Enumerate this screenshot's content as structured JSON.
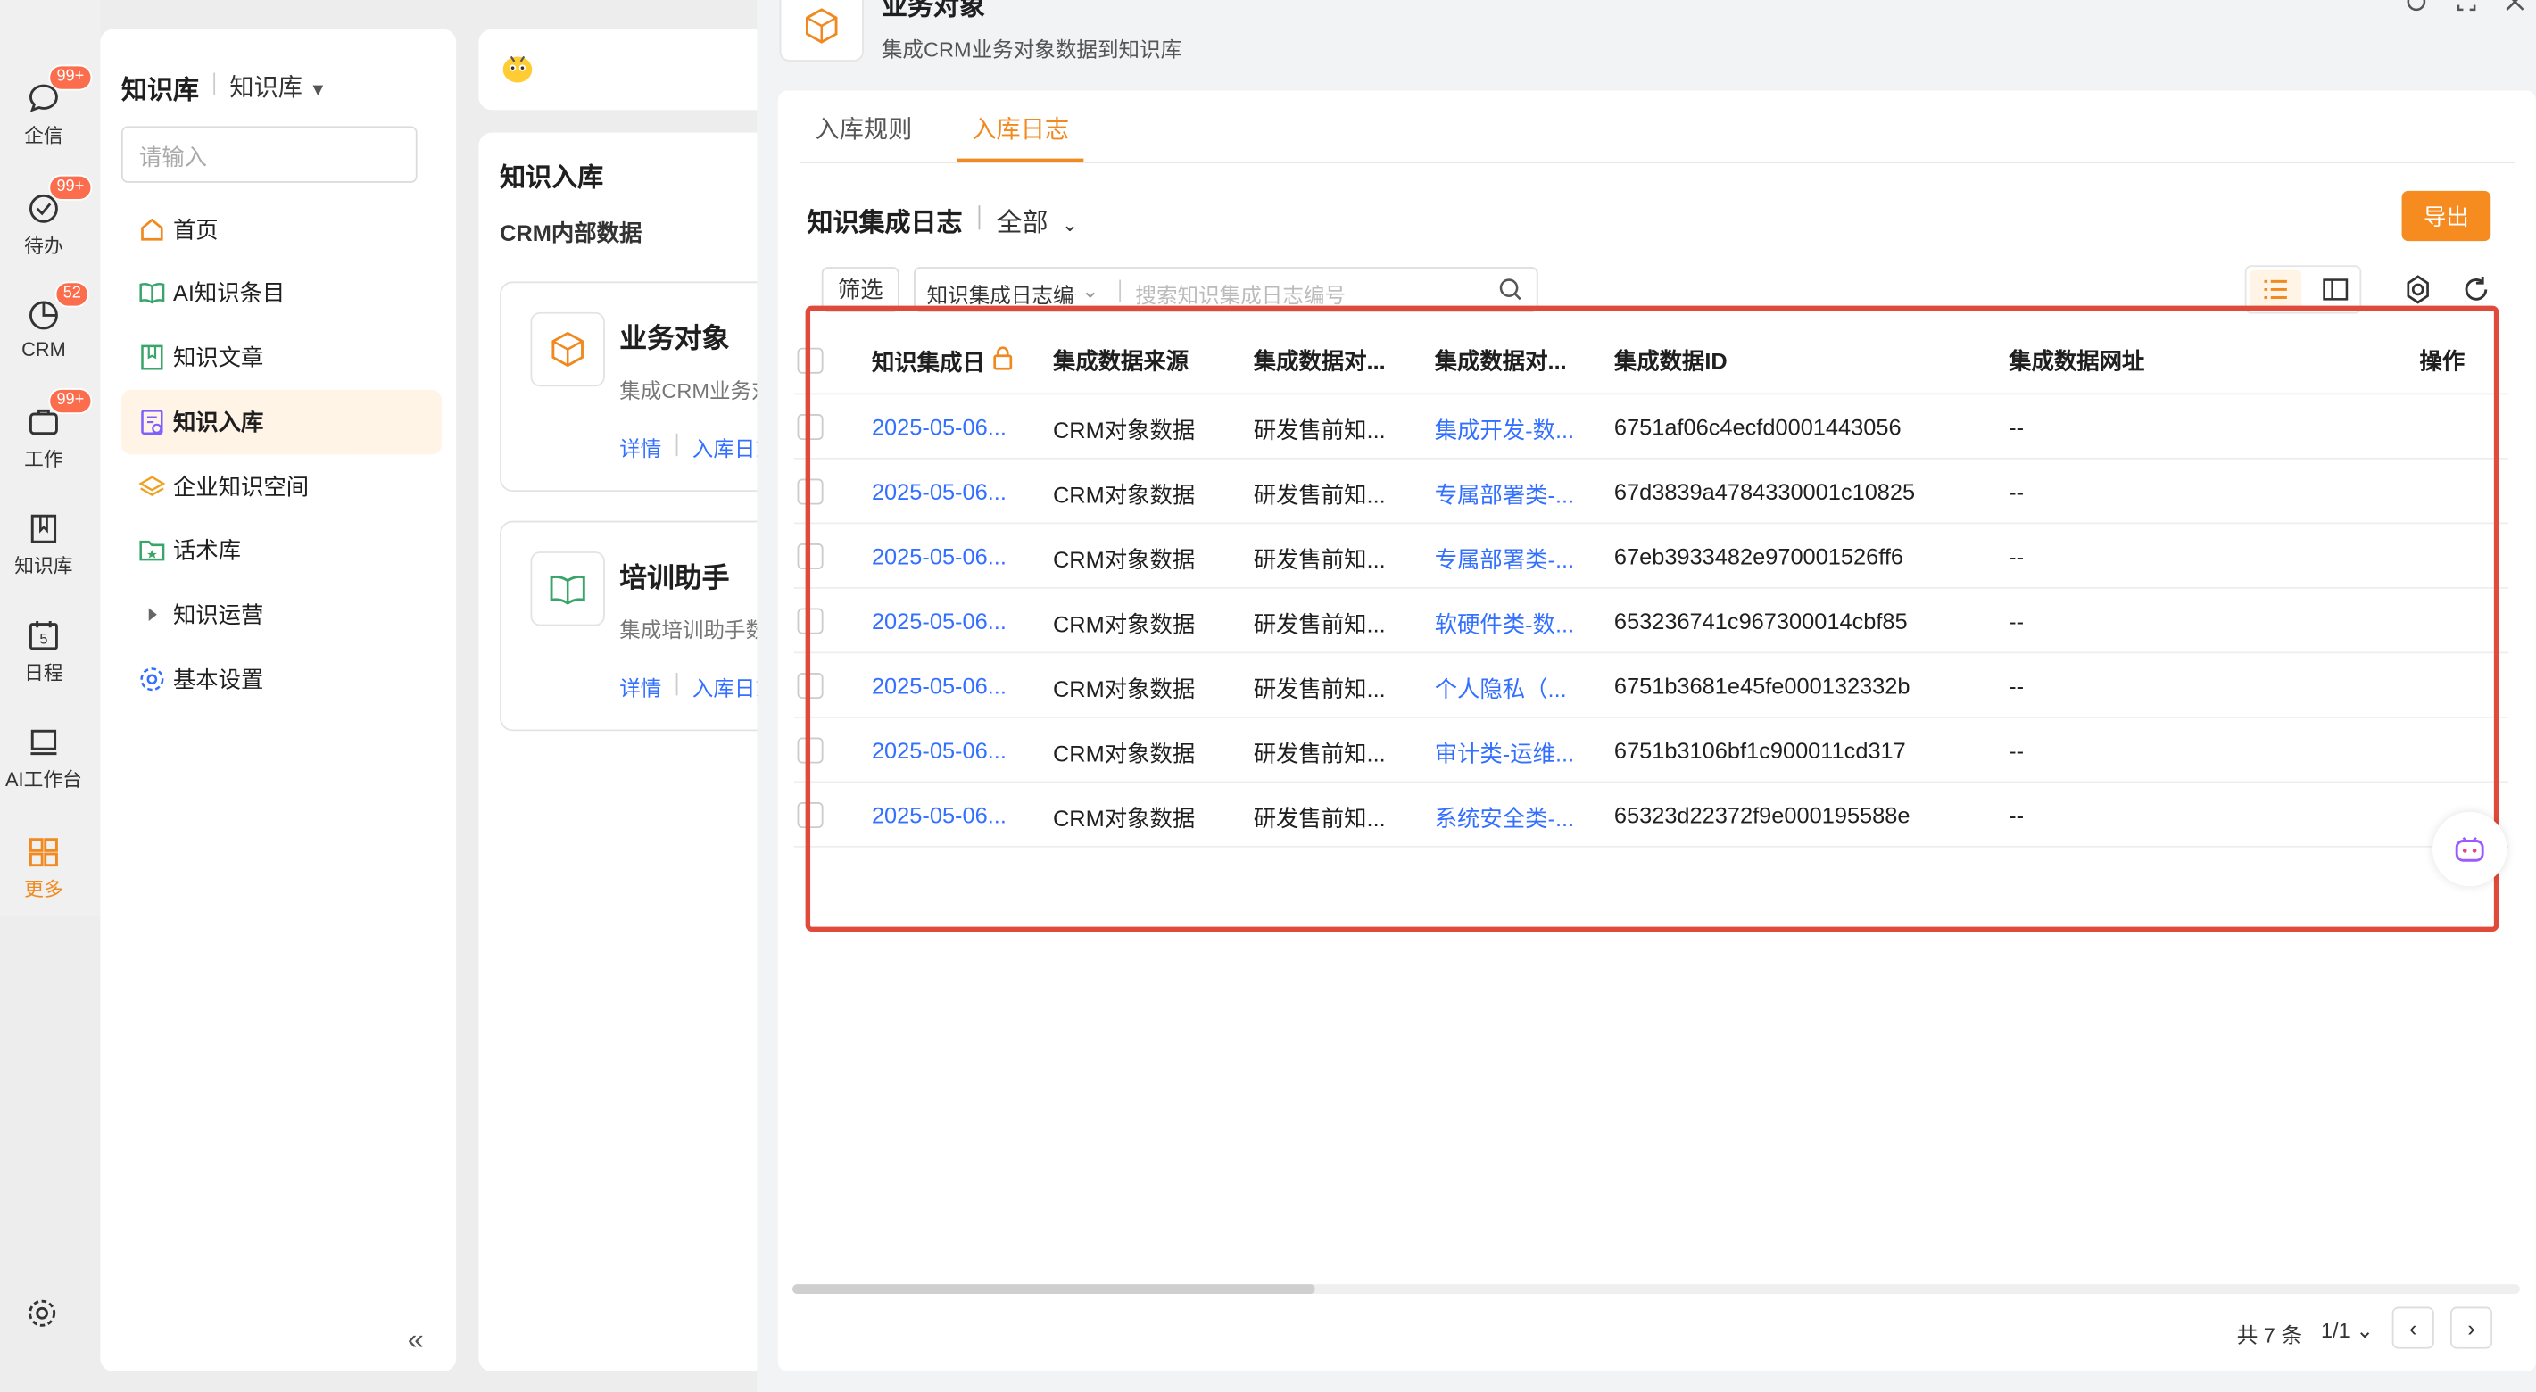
{
  "rail": {
    "items": [
      {
        "label": "企信",
        "badge": "99+"
      },
      {
        "label": "待办",
        "badge": "99+"
      },
      {
        "label": "CRM",
        "badge": "52"
      },
      {
        "label": "工作",
        "badge": "99+"
      },
      {
        "label": "知识库",
        "badge": ""
      },
      {
        "label": "日程",
        "badge": ""
      },
      {
        "label": "AI工作台",
        "badge": ""
      },
      {
        "label": "更多",
        "badge": ""
      }
    ],
    "calendar_day": "5"
  },
  "kpanel": {
    "title": "知识库",
    "subtitle": "知识库",
    "search_placeholder": "请输入",
    "nav": [
      {
        "label": "首页",
        "icon": "home-icon"
      },
      {
        "label": "AI知识条目",
        "icon": "book-icon"
      },
      {
        "label": "知识文章",
        "icon": "article-icon"
      },
      {
        "label": "知识入库",
        "icon": "import-icon"
      },
      {
        "label": "企业知识空间",
        "icon": "layers-icon"
      },
      {
        "label": "话术库",
        "icon": "folder-icon"
      },
      {
        "label": "知识运营",
        "icon": "play-icon"
      },
      {
        "label": "基本设置",
        "icon": "gear-icon"
      }
    ],
    "active_index": 3,
    "collapse_icon": "«"
  },
  "mid": {
    "title": "知识入库",
    "subtitle": "CRM内部数据",
    "cards": [
      {
        "title": "业务对象",
        "desc": "集成CRM业务对象数据到知识库",
        "link1": "详情",
        "link2": "入库日志"
      },
      {
        "title": "培训助手",
        "desc": "集成培训助手数据到知识库",
        "link1": "详情",
        "link2": "入库日志"
      }
    ]
  },
  "drawer": {
    "title": "业务对象",
    "desc": "集成CRM业务对象数据到知识库",
    "tabs": [
      "入库规则",
      "入库日志"
    ],
    "active_tab": 1,
    "log_title": "知识集成日志",
    "log_scope": "全部",
    "export_label": "导出",
    "filter_label": "筛选",
    "search_select": "知识集成日志编号",
    "search_placeholder": "搜索知识集成日志编号",
    "columns": [
      "知识集成日",
      "集成数据来源",
      "集成数据对...",
      "集成数据对...",
      "集成数据ID",
      "集成数据网址",
      "操作"
    ],
    "rows": [
      {
        "date": "2025-05-06...",
        "source": "CRM对象数据",
        "obj": "研发售前知...",
        "name": "集成开发-数...",
        "id": "6751af06c4ecfd0001443056",
        "url": "--"
      },
      {
        "date": "2025-05-06...",
        "source": "CRM对象数据",
        "obj": "研发售前知...",
        "name": "专属部署类-...",
        "id": "67d3839a4784330001c10825",
        "url": "--"
      },
      {
        "date": "2025-05-06...",
        "source": "CRM对象数据",
        "obj": "研发售前知...",
        "name": "专属部署类-...",
        "id": "67eb3933482e970001526ff6",
        "url": "--"
      },
      {
        "date": "2025-05-06...",
        "source": "CRM对象数据",
        "obj": "研发售前知...",
        "name": "软硬件类-数...",
        "id": "653236741c967300014cbf85",
        "url": "--"
      },
      {
        "date": "2025-05-06...",
        "source": "CRM对象数据",
        "obj": "研发售前知...",
        "name": "个人隐私（...",
        "id": "6751b3681e45fe000132332b",
        "url": "--"
      },
      {
        "date": "2025-05-06...",
        "source": "CRM对象数据",
        "obj": "研发售前知...",
        "name": "审计类-运维...",
        "id": "6751b3106bf1c900011cd317",
        "url": "--"
      },
      {
        "date": "2025-05-06...",
        "source": "CRM对象数据",
        "obj": "研发售前知...",
        "name": "系统安全类-...",
        "id": "65323d22372f9e000195588e",
        "url": "--"
      }
    ],
    "pager_total": "共 7 条",
    "pager_page": "1/1",
    "pager_prev": "‹",
    "pager_next": "›"
  },
  "colors": {
    "accent": "#f08a20",
    "link": "#3370ff",
    "highlight_frame": "#e04a3a"
  }
}
